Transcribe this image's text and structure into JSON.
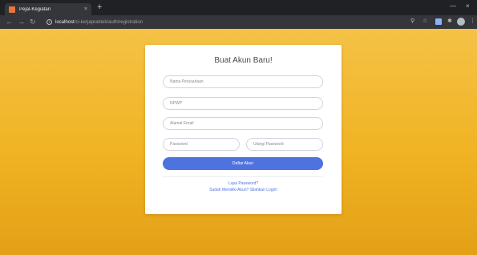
{
  "browser": {
    "tab_title": "Pejal-Kegiatan",
    "tab_close": "×",
    "new_tab": "+",
    "url_host": "localhost",
    "url_path": "/ci-kerjapraktek/auth/registration",
    "minimize": "—",
    "close": "×"
  },
  "form": {
    "title": "Buat Akun Baru!",
    "company_placeholder": "Nama Perusahaan",
    "npwp_placeholder": "NPWP",
    "email_placeholder": "Alamat Email",
    "password_placeholder": "Password",
    "repeat_password_placeholder": "Ulangi Password",
    "submit_label": "Daftar Akun",
    "forgot_password_link": "Lupa Password?",
    "login_link": "Sudah Memiliki Akun? Silahkan Login!"
  },
  "colors": {
    "primary": "#4e73df",
    "background": "#f0b323"
  }
}
